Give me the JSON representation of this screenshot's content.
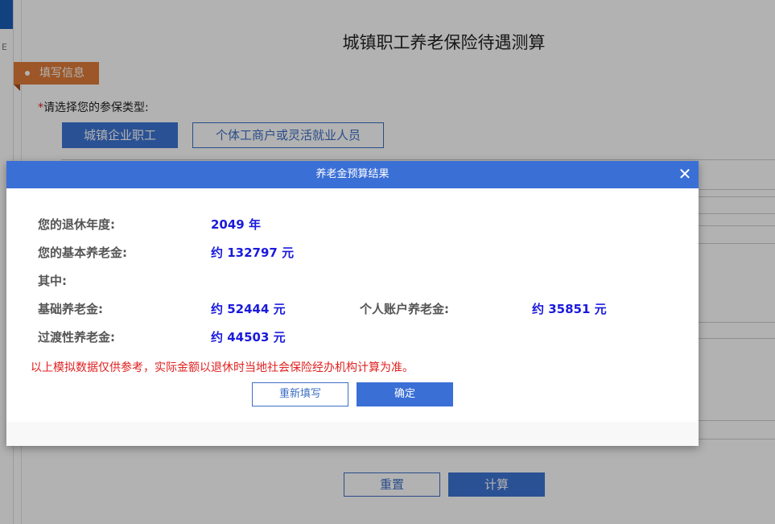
{
  "page": {
    "left_rail_mark": "E",
    "title": "城镇职工养老保险待遇测算",
    "section_tag": "填写信息",
    "type_prompt_required": "*",
    "type_prompt": "请选择您的参保类型:",
    "type_options": [
      "城镇企业职工",
      "个体工商户或灵活就业人员"
    ],
    "selected_type": "城镇企业职工",
    "reset_label": "重置",
    "calc_label": "计算"
  },
  "modal": {
    "title": "养老金预算结果",
    "close_icon": "close-icon",
    "retire_year_label": "您的退休年度:",
    "retire_year_value": "2049 年",
    "basic_pension_label": "您的基本养老金:",
    "basic_pension_value": "约 132797 元",
    "of_which_label": "其中:",
    "base_pension_label": "基础养老金:",
    "base_pension_value": "约 52444 元",
    "personal_account_label": "个人账户养老金:",
    "personal_account_value": "约 35851 元",
    "transition_pension_label": "过渡性养老金:",
    "transition_pension_value": "约 44503 元",
    "disclaimer": "以上模拟数据仅供参考，实际金额以退休时当地社会保险经办机构计算为准。",
    "refill_label": "重新填写",
    "confirm_label": "确定"
  },
  "colors": {
    "header_blue": "#3a6fd6",
    "value_blue": "#1a1adc",
    "tag_orange": "#e07b39",
    "warning_red": "#e02020"
  }
}
